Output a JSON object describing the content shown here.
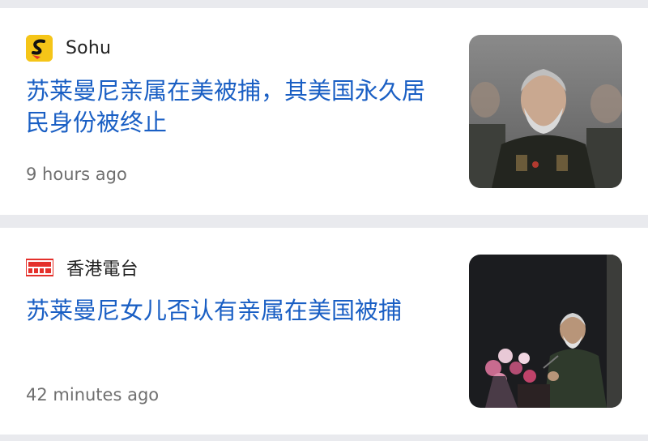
{
  "articles": [
    {
      "source": "Sohu",
      "headline": "苏莱曼尼亲属在美被捕，其美国永久居民身份被终止",
      "time": "9 hours ago",
      "logo_icon": "sohu-logo-icon",
      "thumbnail": "soleimani-portrait-image"
    },
    {
      "source": "香港電台",
      "headline": "苏莱曼尼女儿否认有亲属在美国被捕",
      "time": "42 minutes ago",
      "logo_icon": "rthk-logo-icon",
      "thumbnail": "speaker-at-podium-image"
    }
  ],
  "colors": {
    "headline": "#1a5fc4",
    "page_background": "#e9eaee",
    "card_background": "#ffffff",
    "timestamp": "#6f6f6f",
    "sohu_brand": "#f5c518",
    "rthk_brand": "#e4302b"
  }
}
